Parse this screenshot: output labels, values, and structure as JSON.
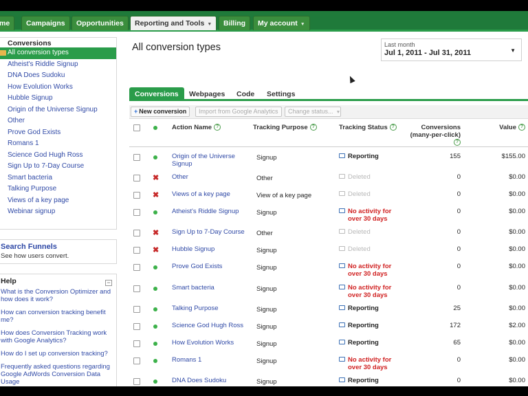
{
  "nav": {
    "tabs": [
      {
        "label": "Home"
      },
      {
        "label": "Campaigns"
      },
      {
        "label": "Opportunities"
      },
      {
        "label": "Reporting and Tools"
      },
      {
        "label": "Billing"
      },
      {
        "label": "My account"
      }
    ]
  },
  "sidebar": {
    "conversions_title": "Conversions",
    "items": [
      "All conversion types",
      "Atheist's Riddle Signup",
      "DNA Does Sudoku",
      "How Evolution Works",
      "Hubble Signup",
      "Origin of the Universe Signup",
      "Other",
      "Prove God Exists",
      "Romans 1",
      "Science God Hugh Ross",
      "Sign Up to 7-Day Course",
      "Smart bacteria",
      "Talking Purpose",
      "Views of a key page",
      "Webinar signup"
    ],
    "funnel_title": "Search Funnels",
    "funnel_sub": "See how users convert.",
    "help_title": "Help",
    "help_minus": "−",
    "help_questions": [
      "What is the Conversion Optimizer and how does it work?",
      "How can conversion tracking benefit me?",
      "How does Conversion Tracking work with Google Analytics?",
      "How do I set up conversion tracking?",
      "Frequently asked questions regarding Google AdWords Conversion Data Usage"
    ]
  },
  "main": {
    "title": "All conversion types",
    "date_label": "Last month",
    "date_range": "Jul 1, 2011 - Jul 31, 2011",
    "tabs": [
      "Conversions",
      "Webpages",
      "Code",
      "Settings"
    ],
    "toolbar": {
      "new_conversion": "New conversion",
      "import": "Import from Google Analytics",
      "change_status": "Change status..."
    },
    "headers": {
      "action_name": "Action Name",
      "tracking_purpose": "Tracking Purpose",
      "tracking_status": "Tracking Status",
      "conversions": "Conversions",
      "conversions_sub": "(many-per-click)",
      "value": "Value"
    },
    "rows": [
      {
        "name": "Origin of the Universe Signup",
        "purpose": "Signup",
        "status": "Reporting",
        "status_type": "rep",
        "active": true,
        "conversions": "155",
        "value": "$155.00"
      },
      {
        "name": "Other",
        "purpose": "Other",
        "status": "Deleted",
        "status_type": "del",
        "active": false,
        "conversions": "0",
        "value": "$0.00"
      },
      {
        "name": "Views of a key page",
        "purpose": "View of a key page",
        "status": "Deleted",
        "status_type": "del",
        "active": false,
        "conversions": "0",
        "value": "$0.00"
      },
      {
        "name": "Atheist's Riddle Signup",
        "purpose": "Signup",
        "status": "No activity for over 30 days",
        "status_type": "na",
        "active": true,
        "conversions": "0",
        "value": "$0.00"
      },
      {
        "name": "Sign Up to 7-Day Course",
        "purpose": "Other",
        "status": "Deleted",
        "status_type": "del",
        "active": false,
        "conversions": "0",
        "value": "$0.00"
      },
      {
        "name": "Hubble Signup",
        "purpose": "Signup",
        "status": "Deleted",
        "status_type": "del",
        "active": false,
        "conversions": "0",
        "value": "$0.00"
      },
      {
        "name": "Prove God Exists",
        "purpose": "Signup",
        "status": "No activity for over 30 days",
        "status_type": "na",
        "active": true,
        "conversions": "0",
        "value": "$0.00"
      },
      {
        "name": "Smart bacteria",
        "purpose": "Signup",
        "status": "No activity for over 30 days",
        "status_type": "na",
        "active": true,
        "conversions": "0",
        "value": "$0.00"
      },
      {
        "name": "Talking Purpose",
        "purpose": "Signup",
        "status": "Reporting",
        "status_type": "rep",
        "active": true,
        "conversions": "25",
        "value": "$0.00"
      },
      {
        "name": "Science God Hugh Ross",
        "purpose": "Signup",
        "status": "Reporting",
        "status_type": "rep",
        "active": true,
        "conversions": "172",
        "value": "$2.00"
      },
      {
        "name": "How Evolution Works",
        "purpose": "Signup",
        "status": "Reporting",
        "status_type": "rep",
        "active": true,
        "conversions": "65",
        "value": "$0.00"
      },
      {
        "name": "Romans 1",
        "purpose": "Signup",
        "status": "No activity for over 30 days",
        "status_type": "na",
        "active": true,
        "conversions": "0",
        "value": "$0.00"
      },
      {
        "name": "DNA Does Sudoku",
        "purpose": "Signup",
        "status": "Reporting",
        "status_type": "rep",
        "active": true,
        "conversions": "0",
        "value": "$0.00"
      }
    ]
  },
  "colors": {
    "nav_green": "#1f7a3a",
    "accent_green": "#2a9c4a",
    "link_blue": "#2f49a6",
    "error_red": "#d02020"
  }
}
